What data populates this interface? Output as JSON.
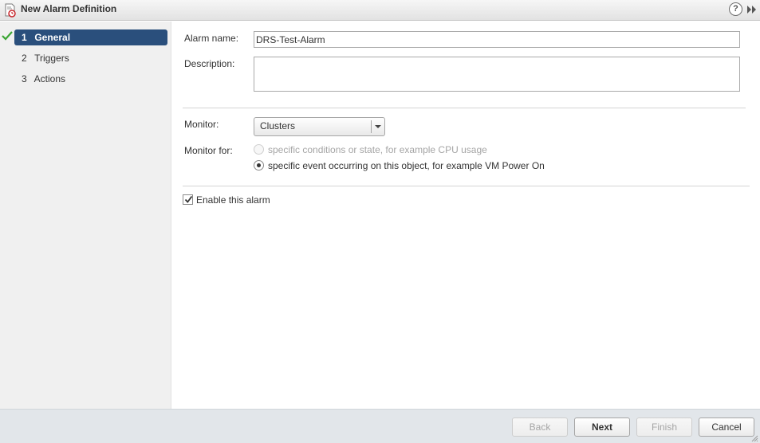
{
  "window": {
    "title": "New Alarm Definition",
    "help_label": "?"
  },
  "steps": [
    {
      "number": "1",
      "label": "General",
      "active": true,
      "completed": true
    },
    {
      "number": "2",
      "label": "Triggers",
      "active": false,
      "completed": false
    },
    {
      "number": "3",
      "label": "Actions",
      "active": false,
      "completed": false
    }
  ],
  "form": {
    "alarm_name_label": "Alarm name:",
    "alarm_name_value": "DRS-Test-Alarm",
    "description_label": "Description:",
    "description_value": "",
    "monitor_label": "Monitor:",
    "monitor_value": "Clusters",
    "monitor_for_label": "Monitor for:",
    "monitor_for_options": [
      {
        "label": "specific conditions or state, for example CPU usage",
        "selected": false,
        "disabled": true
      },
      {
        "label": "specific event occurring on this object, for example VM Power On",
        "selected": true,
        "disabled": false
      }
    ],
    "enable_label": "Enable this alarm",
    "enable_checked": true
  },
  "buttons": {
    "back": "Back",
    "next": "Next",
    "finish": "Finish",
    "cancel": "Cancel"
  },
  "colors": {
    "active_step": "#2a4f7c",
    "check_mark": "#3ba534",
    "footer": "#e2e6ea"
  },
  "icons": {
    "title": "alarm-definition-icon",
    "help": "help-icon",
    "expand": "double-chevron-right-icon",
    "step_done": "check-icon",
    "dropdown": "chevron-down-icon"
  }
}
